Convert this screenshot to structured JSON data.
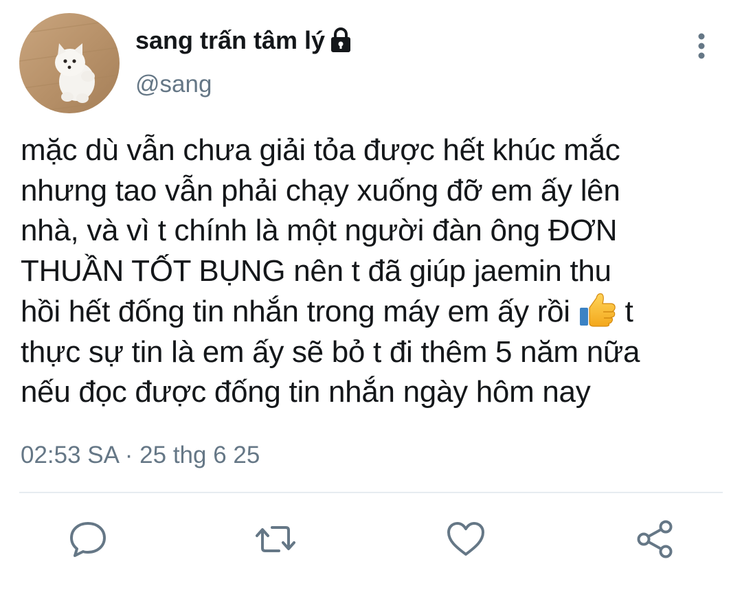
{
  "user": {
    "display_name": "sang trấn tâm lý",
    "handle": "@sang",
    "protected_icon": "lock-icon",
    "avatar_description": "white-puppy-photo"
  },
  "tweet": {
    "text_before_emoji": "mặc dù vẫn chưa giải tỏa được hết khúc mắc\nnhưng tao vẫn phải chạy xuống đỡ em ấy lên\nnhà, và vì t chính là một người đàn ông ĐƠN\nTHUẦN TỐT BỤNG nên t đã giúp jaemin thu\nhồi hết đống tin nhắn trong máy em ấy rồi ",
    "emoji": "thumbs-up",
    "text_after_emoji": " t\nthực sự tin là em ấy sẽ bỏ t đi thêm 5 năm nữa\nnếu đọc được đống tin nhắn ngày hôm nay",
    "timestamp": "02:53 SA · 25 thg 6 25"
  },
  "actions": {
    "reply_icon": "reply-icon",
    "retweet_icon": "retweet-icon",
    "like_icon": "heart-icon",
    "share_icon": "share-icon"
  },
  "colors": {
    "text_primary": "#14171a",
    "text_secondary": "#657786",
    "icon_gray": "#657786",
    "divider": "#e6ecf0"
  }
}
